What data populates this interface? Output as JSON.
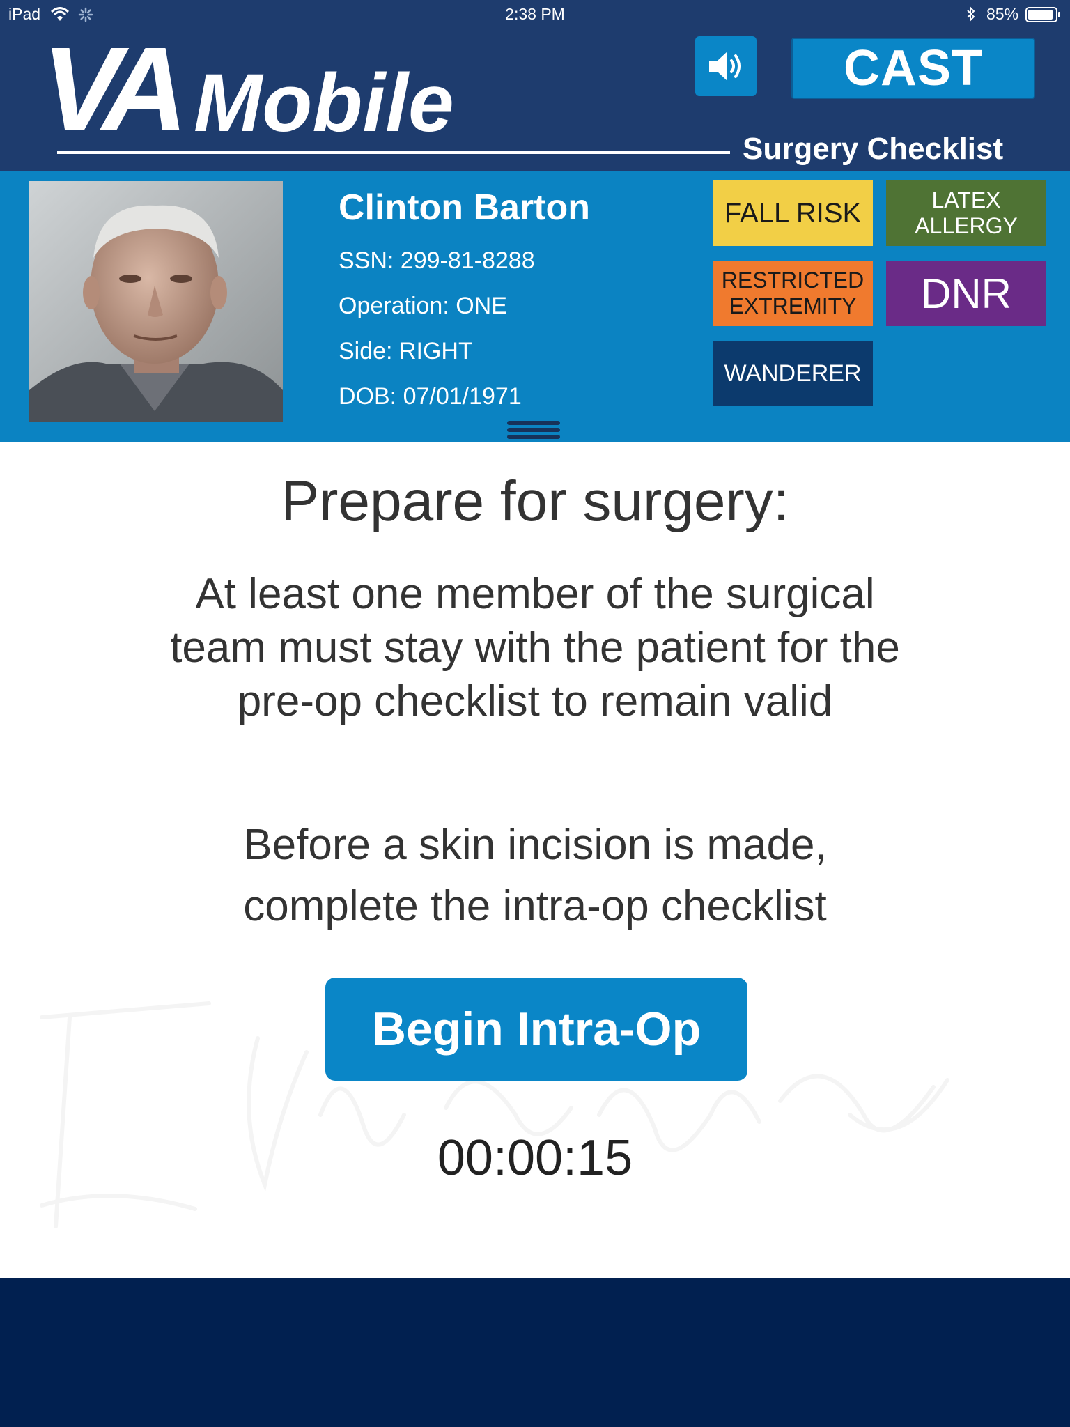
{
  "status_bar": {
    "device": "iPad",
    "time": "2:38 PM",
    "battery": "85%",
    "icons": [
      "wifi-icon",
      "activity-spinner-icon",
      "bluetooth-icon",
      "battery-icon"
    ]
  },
  "header": {
    "logo_text_va": "VA",
    "logo_text_mobile": "Mobile",
    "subtitle": "Surgery Checklist",
    "sound_icon": "speaker-volume-icon",
    "cast_label": "CAST"
  },
  "patient": {
    "name": "Clinton Barton",
    "ssn": "SSN: 299-81-8288",
    "operation": "Operation: ONE",
    "side": "Side: RIGHT",
    "dob": "DOB: 07/01/1971",
    "badges": {
      "fall_risk": "FALL RISK",
      "latex_line1": "LATEX",
      "latex_line2": "ALLERGY",
      "restricted_line1": "RESTRICTED",
      "restricted_line2": "EXTREMITY",
      "dnr": "DNR",
      "wanderer": "WANDERER"
    }
  },
  "main": {
    "heading": "Prepare for surgery:",
    "para1": {
      "line1": "At least one member of the surgical",
      "line2": "team must stay with the patient for the",
      "line3": "pre-op checklist to remain valid"
    },
    "para2": {
      "line1": "Before a skin incision is made,",
      "line2": "complete the intra-op checklist"
    },
    "begin_label": "Begin Intra-Op",
    "timer": "00:00:15"
  },
  "colors": {
    "header_bg": "#1e3c6e",
    "patient_bg": "#0b83c2",
    "button_blue": "#0a86c7",
    "footer_bg": "#012050",
    "fall_risk": "#f2cf46",
    "latex_allergy": "#4f7334",
    "restricted_extremity": "#f07a2e",
    "dnr": "#6a2b87",
    "wanderer": "#0c3a6d"
  }
}
